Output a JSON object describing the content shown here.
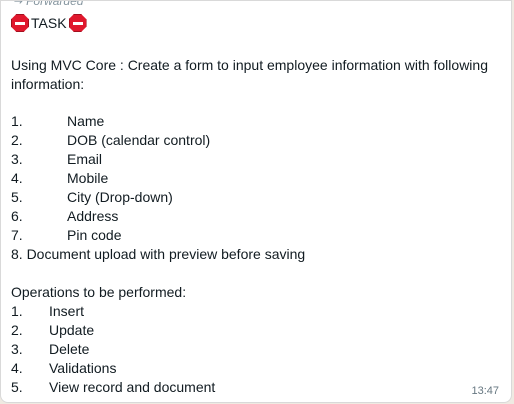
{
  "message": {
    "forwarded_label": "Forwarded",
    "title": "TASK",
    "intro_line1": "Using MVC Core : Create a form to input employee information with following",
    "intro_line2": "information:",
    "fields": [
      {
        "num": "1.",
        "label": "Name"
      },
      {
        "num": "2.",
        "label": "DOB (calendar control)"
      },
      {
        "num": "3.",
        "label": "Email"
      },
      {
        "num": "4.",
        "label": "Mobile"
      },
      {
        "num": "5.",
        "label": "City (Drop-down)"
      },
      {
        "num": "6.",
        "label": "Address"
      },
      {
        "num": "7.",
        "label": "Pin code"
      }
    ],
    "field8": "8. Document upload with preview before saving",
    "operations_heading": "Operations to be performed:",
    "operations": [
      {
        "num": "1.",
        "label": "Insert"
      },
      {
        "num": "2.",
        "label": "Update"
      },
      {
        "num": "3.",
        "label": "Delete"
      },
      {
        "num": "4.",
        "label": "Validations"
      },
      {
        "num": "5.",
        "label": "View record and document"
      }
    ],
    "timestamp": "13:47"
  },
  "icons": {
    "stop": "stop-sign-icon",
    "forward": "forward-arrow-icon"
  },
  "colors": {
    "bubble": "#ffffff",
    "text": "#111b21",
    "meta": "#667781",
    "stop_sign": "#e0182d"
  }
}
